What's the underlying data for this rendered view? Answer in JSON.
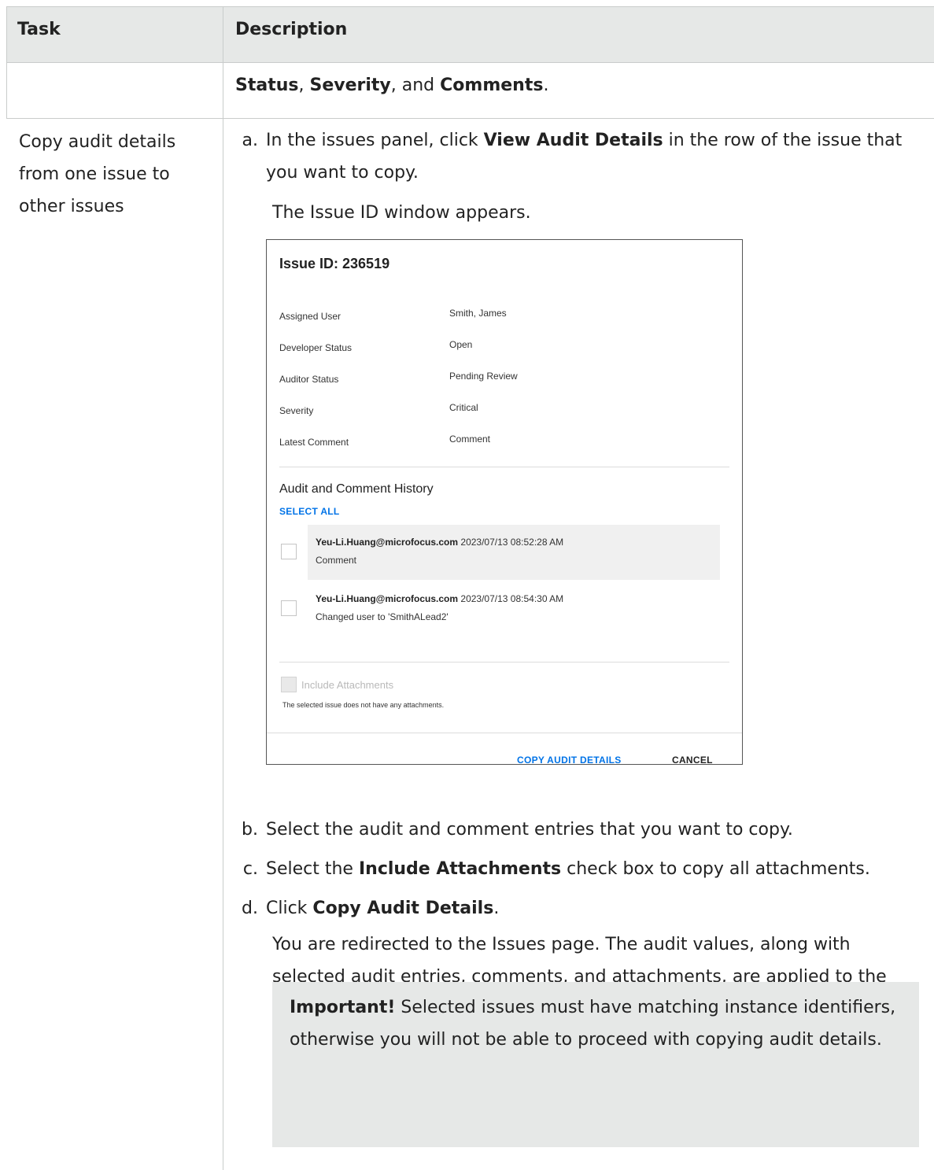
{
  "header": {
    "task": "Task",
    "description": "Description"
  },
  "row1": {
    "status": "Status",
    "sep1": ", ",
    "severity": "Severity",
    "sep2": ", and ",
    "comments": "Comments",
    "end": "."
  },
  "row2": {
    "task_line1": "Copy audit details",
    "task_line2": "from one issue to",
    "task_line3": "other issues",
    "step_a": {
      "label": "a.",
      "pre": "In the issues panel, click ",
      "bold": "View Audit Details",
      "post": " in the row of the issue that you want to copy."
    },
    "window_appears": "The Issue ID window appears.",
    "step_b": {
      "label": "b.",
      "text": "Select the audit and comment entries that you want to copy."
    },
    "step_c": {
      "label": "c.",
      "pre": "Select the ",
      "bold": "Include Attachments",
      "post": " check box to copy all attachments."
    },
    "step_d": {
      "label": "d.",
      "pre": "Click ",
      "bold": "Copy Audit Details",
      "post": "."
    },
    "redirect_text": "You are redirected to the Issues page. The audit values, along with selected audit entries, comments, and attachments, are applied to the other selected issues.",
    "note": {
      "bold": "Important!",
      "text": " Selected issues must have matching instance identifiers, otherwise you will not be able to proceed with copying audit details."
    }
  },
  "dialog": {
    "title": "Issue ID: 236519",
    "fields": [
      {
        "key": "Assigned User",
        "value": "Smith, James"
      },
      {
        "key": "Developer Status",
        "value": "Open"
      },
      {
        "key": "Auditor Status",
        "value": "Pending Review"
      },
      {
        "key": "Severity",
        "value": "Critical"
      },
      {
        "key": "Latest Comment",
        "value": "Comment"
      }
    ],
    "history_title": "Audit and Comment History",
    "select_all": "SELECT ALL",
    "history": [
      {
        "user": "Yeu-Li.Huang@microfocus.com",
        "time": "2023/07/13 08:52:28 AM",
        "text": "Comment"
      },
      {
        "user": "Yeu-Li.Huang@microfocus.com",
        "time": "2023/07/13 08:54:30 AM",
        "text": "Changed user to 'SmithALead2'"
      }
    ],
    "include_attachments": "Include Attachments",
    "no_attachments": "The selected issue does not have any attachments.",
    "copy_button": "COPY AUDIT DETAILS",
    "cancel_button": "CANCEL"
  }
}
